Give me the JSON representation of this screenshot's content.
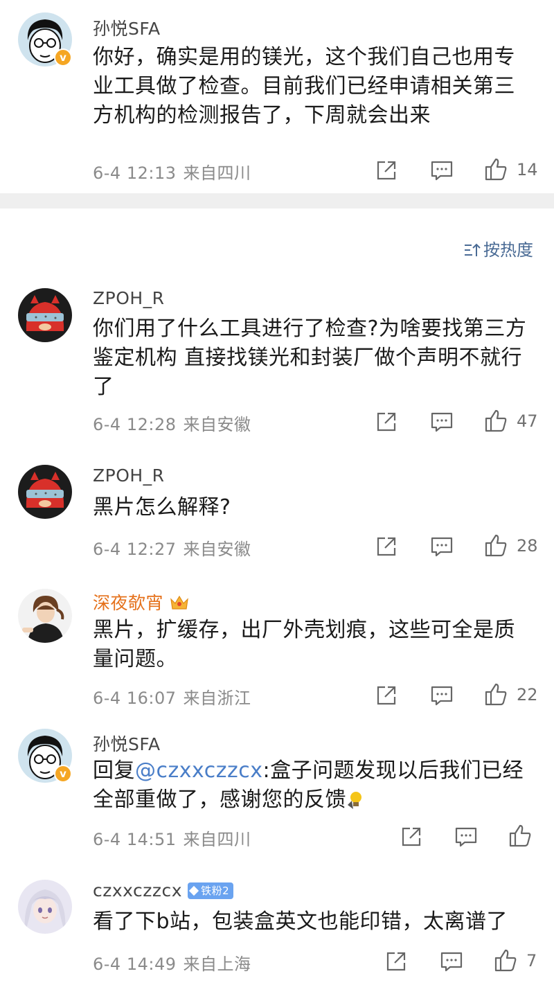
{
  "comments": [
    {
      "user": "孙悦SFA",
      "text": "你好，确实是用的镁光，这个我们自己也用专业工具做了检查。目前我们已经申请相关第三方机构的检测报告了，下周就会出来",
      "date": "6-4 12:13",
      "location": "来自四川",
      "likes": "14"
    },
    {
      "user": "ZPOH_R",
      "text": "你们用了什么工具进行了检查?为啥要找第三方鉴定机构 直接找镁光和封装厂做个声明不就行了",
      "date": "6-4 12:28",
      "location": "来自安徽",
      "likes": "47"
    },
    {
      "user": "ZPOH_R",
      "text": "黑片怎么解释?",
      "date": "6-4 12:27",
      "location": "来自安徽",
      "likes": "28"
    },
    {
      "user": "深夜欹宵",
      "text": "黑片，扩缓存，出厂外壳划痕，这些可全是质量问题。",
      "date": "6-4 16:07",
      "location": "来自浙江",
      "likes": "22"
    },
    {
      "user": "孙悦SFA",
      "text_prefix": "回复",
      "mention": "@czxxczzcx",
      "text": ":盒子问题发现以后我们已经全部重做了，感谢您的反馈",
      "date": "6-4 14:51",
      "location": "来自四川",
      "likes": ""
    },
    {
      "user": "czxxczzcx",
      "badge": "铁粉2",
      "text": "看了下b站，包装盒英文也能印错，太离谱了",
      "date": "6-4 14:49",
      "location": "来自上海",
      "likes": "7"
    }
  ],
  "sort": {
    "label": "按热度"
  },
  "icons": [
    "share-icon",
    "comment-icon",
    "like-icon",
    "verified-icon",
    "crown-icon",
    "sort-icon",
    "lightbulb-icon"
  ],
  "colors": {
    "username": "#444444",
    "vip_username": "#e5711b",
    "mention": "#4a7ec8",
    "meta": "#8a8a8a",
    "sort": "#4a6b95",
    "divider": "#efefef",
    "verified": "#f5a623",
    "fan_badge": "#6aa3f0"
  }
}
